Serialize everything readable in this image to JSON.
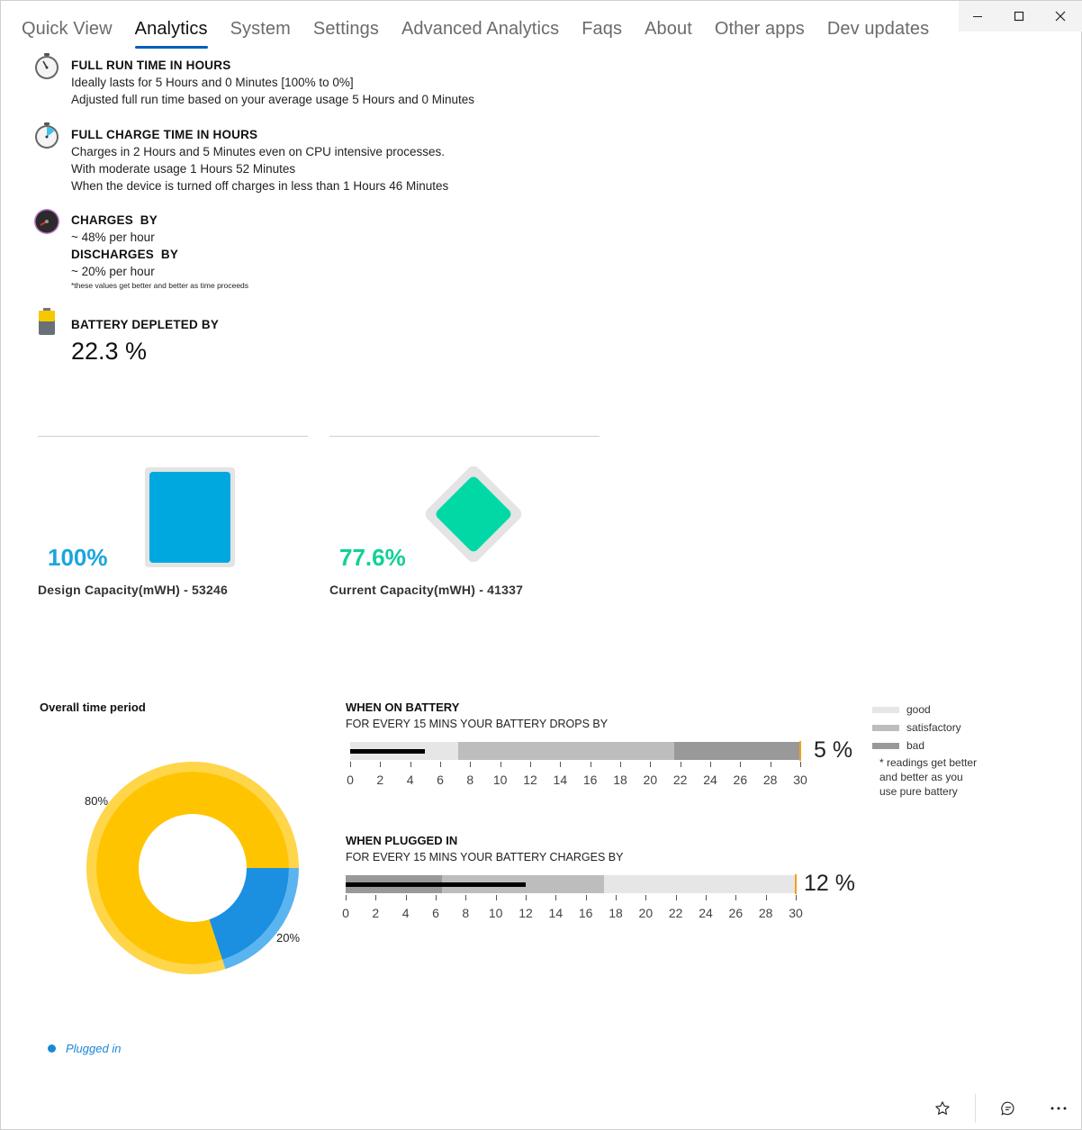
{
  "window": {
    "minimize_glyph": "minimize-icon",
    "maximize_glyph": "maximize-icon",
    "close_glyph": "close-icon"
  },
  "nav": {
    "items": [
      "Quick View",
      "Analytics",
      "System",
      "Settings",
      "Advanced Analytics",
      "Faqs",
      "About",
      "Other apps",
      "Dev updates"
    ],
    "active": "Analytics"
  },
  "run_time": {
    "icon": "stopwatch-icon",
    "title": "FULL RUN TIME IN HOURS",
    "line1": "Ideally lasts for 5 Hours and 0 Minutes [100% to 0%]",
    "line2": "Adjusted full run time based on your average usage 5 Hours and 0 Minutes"
  },
  "charge_time": {
    "icon": "timer-icon",
    "title": "FULL CHARGE TIME IN HOURS",
    "line1": "Charges in 2 Hours and 5 Minutes even on CPU intensive processes.",
    "line2": "With moderate usage 1 Hours 52 Minutes",
    "line3": "When the device is turned off charges in less than 1 Hours 46 Minutes"
  },
  "rates": {
    "icon": "speedometer-icon",
    "charges_title": "CHARGES  BY",
    "charges_value": "~ 48% per hour",
    "discharges_title": "DISCHARGES  BY",
    "discharges_value": "~ 20% per hour",
    "note": "*these values get better and better as time proceeds"
  },
  "depleted": {
    "icon": "battery-icon",
    "title": "BATTERY DEPLETED BY",
    "value": "22.3 %"
  },
  "design_capacity": {
    "percent": "100%",
    "label": "Design Capacity(mWH) - 53246",
    "fraction": 1.0,
    "color": "#00a8e0"
  },
  "current_capacity": {
    "percent": "77.6%",
    "label": "Current Capacity(mWH) - 41337",
    "fraction": 0.776,
    "color": "#00d9a6"
  },
  "pie": {
    "title": "Overall time period",
    "legend_label": "Plugged in",
    "slices": [
      {
        "label": "80%",
        "value": 80,
        "color": "#ffc400"
      },
      {
        "label": "20%",
        "value": 20,
        "color": "#1b8fe0"
      }
    ]
  },
  "on_battery": {
    "title": "WHEN ON BATTERY",
    "subtitle": "FOR EVERY 15 MINS YOUR BATTERY DROPS BY",
    "value_text": "5 %",
    "value": 5,
    "target": 30,
    "ranges": [
      {
        "name": "good",
        "from": 0,
        "to": 7.2,
        "color": "#e6e6e6"
      },
      {
        "name": "satisfactory",
        "from": 7.2,
        "to": 21.6,
        "color": "#bdbdbd"
      },
      {
        "name": "bad",
        "from": 21.6,
        "to": 30,
        "color": "#999999"
      }
    ],
    "ticks": [
      "0",
      "2",
      "4",
      "6",
      "8",
      "10",
      "12",
      "14",
      "16",
      "18",
      "20",
      "22",
      "24",
      "26",
      "28",
      "30"
    ]
  },
  "plugged_in": {
    "title": "WHEN PLUGGED IN",
    "subtitle": "FOR EVERY 15 MINS YOUR BATTERY CHARGES BY",
    "value_text": "12 %",
    "value": 12,
    "target": 30,
    "ranges": [
      {
        "name": "bad",
        "from": 0,
        "to": 6.4,
        "color": "#999999"
      },
      {
        "name": "satisfactory",
        "from": 6.4,
        "to": 17.2,
        "color": "#bdbdbd"
      },
      {
        "name": "good",
        "from": 17.2,
        "to": 30,
        "color": "#e6e6e6"
      }
    ],
    "ticks": [
      "0",
      "2",
      "4",
      "6",
      "8",
      "10",
      "12",
      "14",
      "16",
      "18",
      "20",
      "22",
      "24",
      "26",
      "28",
      "30"
    ]
  },
  "legend": {
    "good": "good",
    "satisfactory": "satisfactory",
    "bad": "bad",
    "note": "* readings get better and better as you use pure battery"
  },
  "footer": {
    "favorite_icon": "star-icon",
    "feedback_icon": "chat-icon",
    "more_icon": "more-icon"
  }
}
